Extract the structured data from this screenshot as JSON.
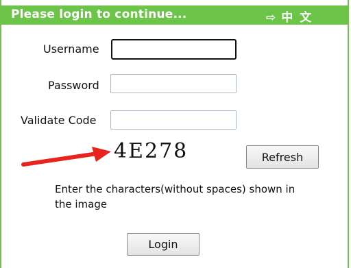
{
  "header": {
    "title": "Please login to continue...",
    "lang_arrow": "⇨",
    "lang_label": "中文"
  },
  "form": {
    "username_label": "Username",
    "password_label": "Password",
    "validate_label": "Validate Code",
    "username_value": "",
    "password_value": "",
    "validate_value": ""
  },
  "captcha": {
    "text": "4E278"
  },
  "buttons": {
    "refresh": "Refresh",
    "login": "Login"
  },
  "hint": {
    "text": "Enter the characters(without spaces) shown in the image"
  },
  "colors": {
    "header_bg": "#6cc449",
    "annotation_arrow": "#e8241e"
  }
}
